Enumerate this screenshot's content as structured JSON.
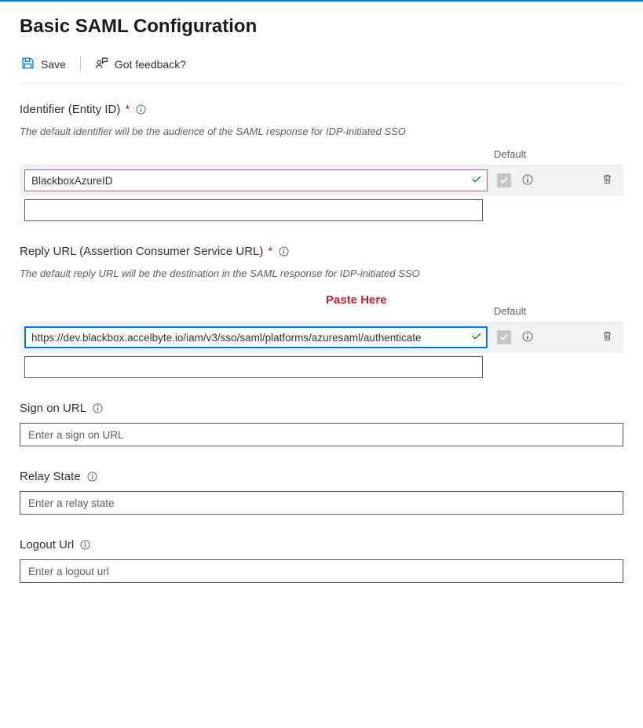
{
  "page": {
    "title": "Basic SAML Configuration"
  },
  "toolbar": {
    "save_label": "Save",
    "feedback_label": "Got feedback?"
  },
  "identifier": {
    "label": "Identifier (Entity ID)",
    "required_mark": "*",
    "description": "The default identifier will be the audience of the SAML response for IDP-initiated SSO",
    "default_header": "Default",
    "rows": [
      {
        "value": "BlackboxAzureID",
        "valid": true,
        "default_checked": true
      }
    ],
    "add_value": ""
  },
  "replyurl": {
    "label": "Reply URL (Assertion Consumer Service URL)",
    "required_mark": "*",
    "annotation": "Paste Here",
    "description": "The default reply URL will be the destination in the SAML response for IDP-initiated SSO",
    "default_header": "Default",
    "rows": [
      {
        "value": "https://dev.blackbox.accelbyte.io/iam/v3/sso/saml/platforms/azuresaml/authenticate",
        "valid": true,
        "default_checked": true
      }
    ],
    "add_value": ""
  },
  "signon": {
    "label": "Sign on URL",
    "placeholder": "Enter a sign on URL",
    "value": ""
  },
  "relay": {
    "label": "Relay State",
    "placeholder": "Enter a relay state",
    "value": ""
  },
  "logout": {
    "label": "Logout Url",
    "placeholder": "Enter a logout url",
    "value": ""
  }
}
